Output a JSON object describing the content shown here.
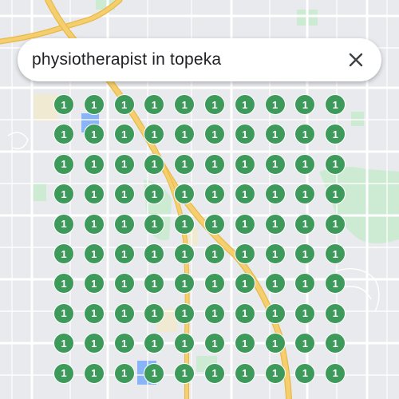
{
  "search": {
    "query": "physiotherapist in topeka"
  },
  "icons": {
    "close": "close-icon"
  },
  "colors": {
    "pin": "#3d9a5b",
    "map_bg": "#e9eaee",
    "highway": "#f5cf6e",
    "park": "#cdebd3",
    "water": "#8ab4f8"
  },
  "pins": {
    "rows": 10,
    "cols": 10,
    "label": "1"
  }
}
